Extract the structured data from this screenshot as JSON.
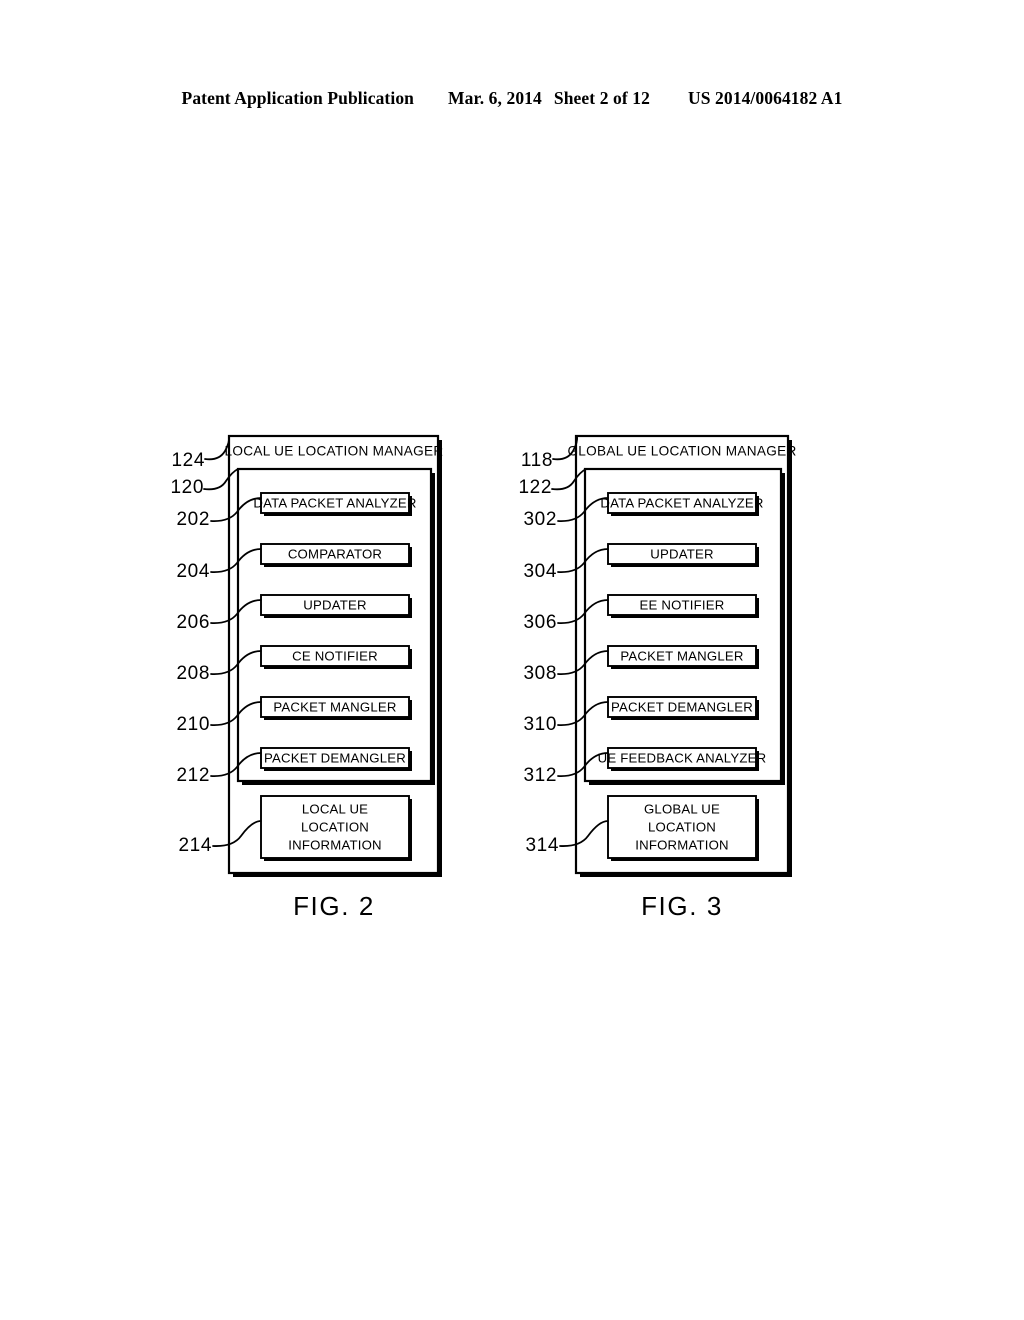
{
  "header": {
    "publication": "Patent Application Publication",
    "date": "Mar. 6, 2014",
    "sheet": "Sheet 2 of 12",
    "patent_number": "US 2014/0064182 A1"
  },
  "figures": [
    {
      "caption": "FIG. 2",
      "outer_ref": "124",
      "inner_ref": "120",
      "title": "LOCAL UE LOCATION MANAGER",
      "modules": [
        {
          "ref": "202",
          "label": "DATA PACKET ANALYZER"
        },
        {
          "ref": "204",
          "label": "COMPARATOR"
        },
        {
          "ref": "206",
          "label": "UPDATER"
        },
        {
          "ref": "208",
          "label": "CE NOTIFIER"
        },
        {
          "ref": "210",
          "label": "PACKET MANGLER"
        },
        {
          "ref": "212",
          "label": "PACKET DEMANGLER"
        }
      ],
      "store": {
        "ref": "214",
        "lines": [
          "LOCAL UE",
          "LOCATION",
          "INFORMATION"
        ]
      }
    },
    {
      "caption": "FIG. 3",
      "outer_ref": "118",
      "inner_ref": "122",
      "title": "GLOBAL UE LOCATION MANAGER",
      "modules": [
        {
          "ref": "302",
          "label": "DATA PACKET ANALYZER"
        },
        {
          "ref": "304",
          "label": "UPDATER"
        },
        {
          "ref": "306",
          "label": "EE NOTIFIER"
        },
        {
          "ref": "308",
          "label": "PACKET MANGLER"
        },
        {
          "ref": "310",
          "label": "PACKET DEMANGLER"
        },
        {
          "ref": "312",
          "label": "UE FEEDBACK ANALYZER"
        }
      ],
      "store": {
        "ref": "314",
        "lines": [
          "GLOBAL UE",
          "LOCATION",
          "INFORMATION"
        ]
      }
    }
  ],
  "colors": {
    "ink": "#000000",
    "paper": "#ffffff"
  }
}
